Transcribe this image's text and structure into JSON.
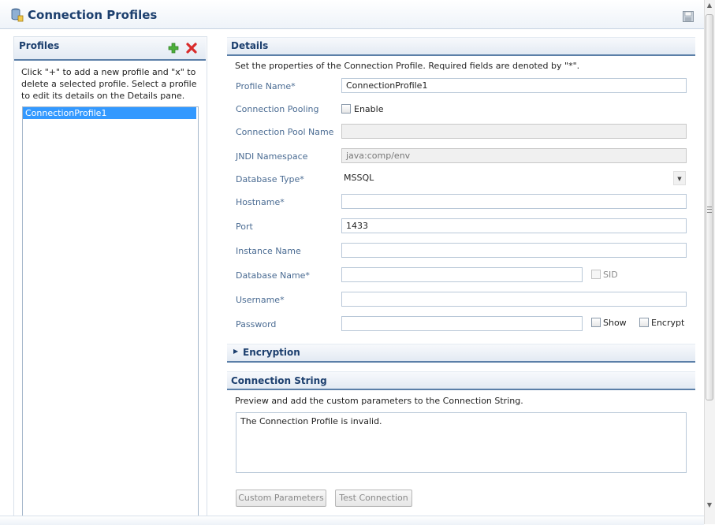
{
  "header": {
    "title": "Connection Profiles"
  },
  "profiles": {
    "title": "Profiles",
    "help": "Click \"+\" to add a new profile and \"x\" to delete a selected profile.  Select a profile to edit its details on the Details pane.",
    "items": [
      {
        "label": "ConnectionProfile1",
        "selected": true
      }
    ]
  },
  "details": {
    "title": "Details",
    "help": "Set the properties of the Connection Profile.  Required fields are denoted by \"*\".",
    "profile_name": {
      "label": "Profile Name*",
      "value": "ConnectionProfile1"
    },
    "connection_pooling": {
      "label": "Connection Pooling",
      "checkbox_label": "Enable",
      "checked": false
    },
    "connection_pool_name": {
      "label": "Connection Pool Name",
      "value": ""
    },
    "jndi_namespace": {
      "label": "JNDI Namespace",
      "value": "java:comp/env"
    },
    "database_type": {
      "label": "Database Type*",
      "value": "MSSQL"
    },
    "hostname": {
      "label": "Hostname*",
      "value": ""
    },
    "port": {
      "label": "Port",
      "value": "1433"
    },
    "instance_name": {
      "label": "Instance Name",
      "value": ""
    },
    "database_name": {
      "label": "Database Name*",
      "value": "",
      "sid_label": "SID"
    },
    "username": {
      "label": "Username*",
      "value": ""
    },
    "password": {
      "label": "Password",
      "value": "",
      "show_label": "Show",
      "encrypt_label": "Encrypt"
    }
  },
  "encryption": {
    "title": "Encryption",
    "expanded": false
  },
  "connection_string": {
    "title": "Connection String",
    "help": "Preview and add the custom parameters to the Connection String.",
    "preview": "The Connection Profile is invalid.",
    "custom_parameters_label": "Custom Parameters",
    "test_connection_label": "Test Connection"
  },
  "colors": {
    "accent": "#5b7fa8",
    "title": "#1c3f6e",
    "label": "#4b6c93",
    "selection": "#3399ff"
  }
}
